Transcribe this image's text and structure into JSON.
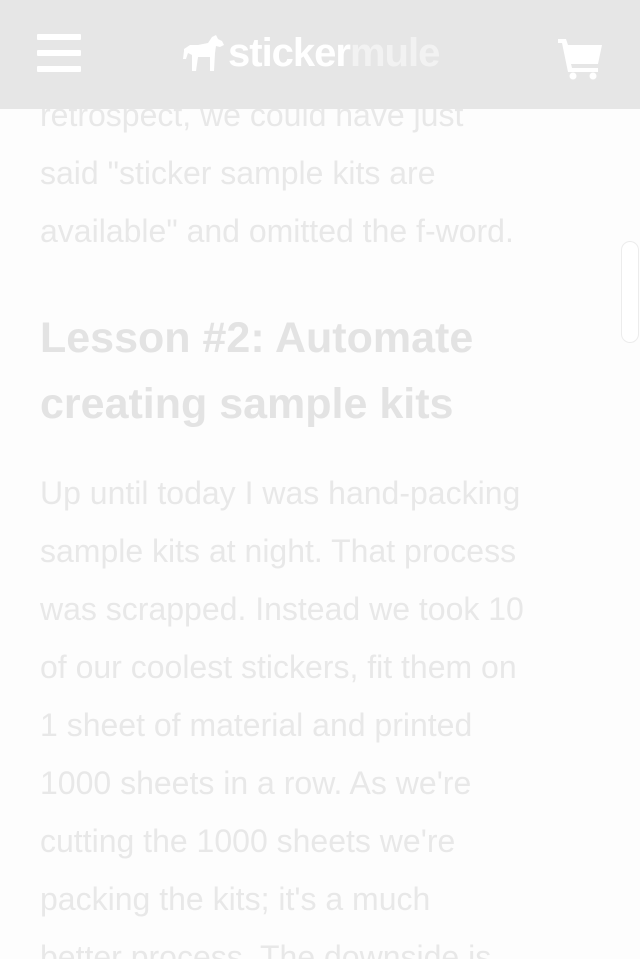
{
  "header": {
    "menu_icon": "hamburger-icon",
    "logo": {
      "part1": "sticker",
      "part2": "mule",
      "icon": "mule-icon"
    },
    "cart_icon": "cart-icon",
    "background": "#e6e6e6"
  },
  "article": {
    "paragraph1_lines": [
      "retrospect, we could have just",
      "said \"sticker sample kits are",
      "available\" and omitted the f-word."
    ],
    "heading_lines": [
      "Lesson #2: Automate",
      "creating sample kits"
    ],
    "paragraph2_lines": [
      "Up until today I was hand-packing",
      "sample kits at night. That process",
      "was scrapped. Instead we took 10",
      "of our coolest stickers, fit them on",
      "1 sheet of material and printed",
      "1000 sheets in a row. As we're",
      "cutting the 1000 sheets we're",
      "packing the kits; it's a much",
      "better process. The downside is"
    ]
  },
  "colors": {
    "text": "#e8e8e8",
    "heading": "#e3e3e3",
    "page_background": "#fdfdfd"
  }
}
